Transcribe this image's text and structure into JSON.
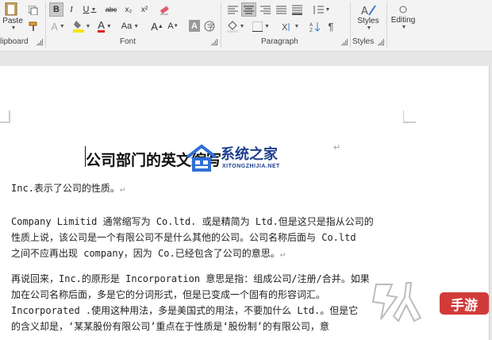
{
  "ribbon": {
    "clipboard": {
      "paste_label": "Paste",
      "group_label": "lipboard"
    },
    "font": {
      "group_label": "Font",
      "bold": "B",
      "italic": "I",
      "underline": "U",
      "strike": "abc",
      "subscript": "x₂",
      "superscript": "x²",
      "font_size_label": "Aa",
      "grow": "A",
      "shrink": "A",
      "char_shading": "A"
    },
    "paragraph": {
      "group_label": "Paragraph"
    },
    "styles": {
      "styles_label": "Styles",
      "group_label": "Styles"
    },
    "editing": {
      "label": "Editing"
    },
    "colors": {
      "highlight": "#f5e600",
      "font_color": "#e0191b"
    }
  },
  "document": {
    "title": "公司部门的英文缩写",
    "paragraphs": [
      [
        "Inc.表示了公司的性质。"
      ],
      [
        "Company Limitid 通常缩写为 Co.ltd. 或是精简为 Ltd.但是这只是指从公司的",
        "性质上说，该公司是一个有限公司不是什么其他的公司。公司名称后面与 Co.ltd",
        "之间不应再出现 company，因为 Co.已经包含了公司的意思。"
      ],
      [
        "再说回来，Inc.的原形是 Incorporation 意思是指：组成公司/注册/合并。如果",
        "加在公司名称后面，多是它的分词形式，但是已变成一个固有的形容词汇。",
        "Incorporated .使用这种用法，多是美国式的用法，不要加什么 Ltd.。但是它",
        "的含义却是，‘某某股份有限公司’重点在于性质是‘股份制’的有限公司，意"
      ]
    ],
    "paragraph_mark": "↵"
  },
  "watermarks": {
    "site_name": "系统之家",
    "site_url": "XITONGZHIJIA.NET",
    "brand": "手游"
  }
}
